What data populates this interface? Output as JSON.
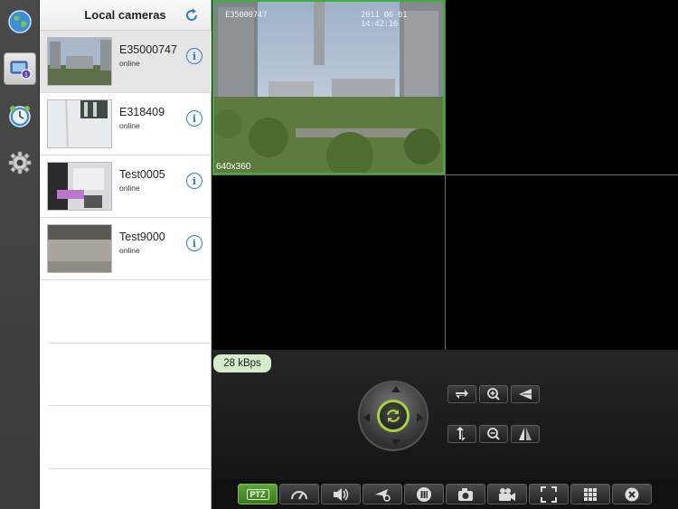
{
  "list": {
    "title": "Local cameras",
    "cameras": [
      {
        "name": "E35000747",
        "status": "online"
      },
      {
        "name": "E318409",
        "status": "online"
      },
      {
        "name": "Test0005",
        "status": "online"
      },
      {
        "name": "Test9000",
        "status": "online"
      }
    ]
  },
  "video": {
    "osd_id": "E35000747",
    "osd_timestamp": "2011 06 01 14:42:16",
    "resolution": "640x360"
  },
  "controls": {
    "bitrate": "28 kBps",
    "ptz_label": "PTZ"
  },
  "colors": {
    "accent_green": "#3fae3f",
    "joystick_ring": "#a5d43a",
    "info_blue": "#2d7dd2"
  }
}
